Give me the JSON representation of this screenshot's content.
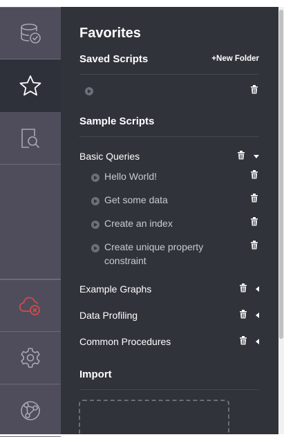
{
  "sidebar": {
    "items": [
      {
        "name": "database",
        "icon": "database-check-icon"
      },
      {
        "name": "favorites",
        "icon": "star-icon",
        "active": true
      },
      {
        "name": "search",
        "icon": "document-search-icon"
      },
      {
        "name": "cloud",
        "icon": "cloud-error-icon"
      },
      {
        "name": "settings",
        "icon": "gear-icon"
      },
      {
        "name": "graph",
        "icon": "graph-nodes-icon"
      }
    ]
  },
  "drawer": {
    "title": "Favorites",
    "saved_scripts": {
      "heading": "Saved Scripts",
      "new_folder_label": "+New Folder",
      "items": [
        {
          "label": ""
        }
      ]
    },
    "sample_scripts": {
      "heading": "Sample Scripts",
      "folders": [
        {
          "label": "Basic Queries",
          "expanded": true,
          "items": [
            {
              "label": "Hello World!"
            },
            {
              "label": "Get some data"
            },
            {
              "label": "Create an index"
            },
            {
              "label": "Create unique property constraint"
            }
          ]
        },
        {
          "label": "Example Graphs",
          "expanded": false
        },
        {
          "label": "Data Profiling",
          "expanded": false
        },
        {
          "label": "Common Procedures",
          "expanded": false
        }
      ]
    },
    "import": {
      "heading": "Import"
    }
  },
  "colors": {
    "sidebar_bg": "#4f4d5b",
    "drawer_bg": "#31333b",
    "active_nav_bg": "#2f313a",
    "error_accent": "#d84a4a"
  }
}
